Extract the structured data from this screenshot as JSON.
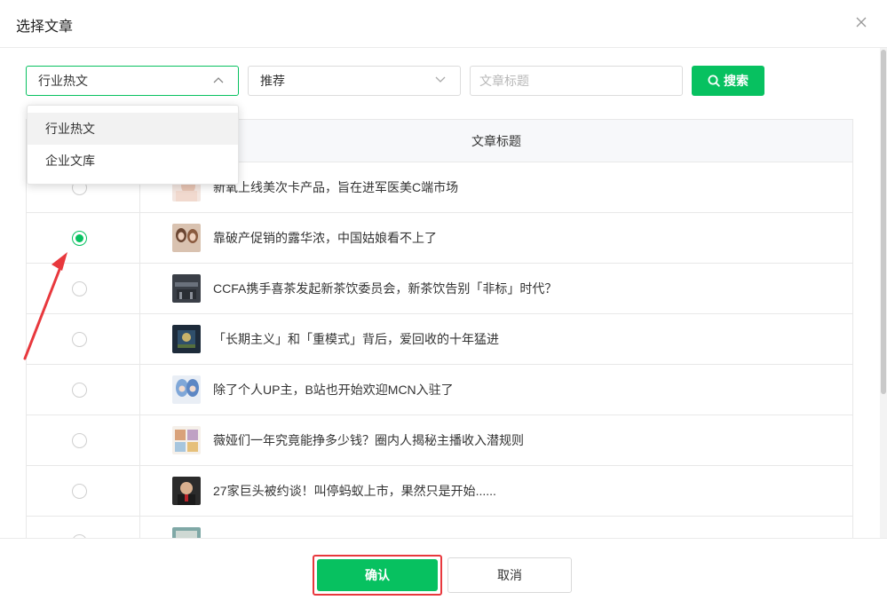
{
  "dialog": {
    "title": "选择文章"
  },
  "filters": {
    "type_select": {
      "value": "行业热文",
      "options": [
        "行业热文",
        "企业文库"
      ]
    },
    "recommend_select": {
      "value": "推荐"
    },
    "title_input": {
      "placeholder": "文章标题",
      "value": ""
    },
    "search_label": "搜索"
  },
  "table": {
    "header": {
      "title": "文章标题"
    },
    "selected_index": 1,
    "rows": [
      {
        "title": "新氧上线美次卡产品，旨在进军医美C端市场",
        "checked": false
      },
      {
        "title": "靠破产促销的露华浓，中国姑娘看不上了",
        "checked": true
      },
      {
        "title": "CCFA携手喜茶发起新茶饮委员会，新茶饮告别「非标」时代？",
        "checked": false
      },
      {
        "title": "「长期主义」和「重模式」背后，爱回收的十年猛进",
        "checked": false
      },
      {
        "title": "除了个人UP主，B站也开始欢迎MCN入驻了",
        "checked": false
      },
      {
        "title": "薇娅们一年究竟能挣多少钱？圈内人揭秘主播收入潜规则",
        "checked": false
      },
      {
        "title": "27家巨头被约谈！叫停蚂蚁上市，果然只是开始......",
        "checked": false
      }
    ]
  },
  "footer": {
    "confirm_label": "确认",
    "cancel_label": "取消"
  },
  "colors": {
    "accent": "#07c160",
    "highlight": "#e8383d"
  }
}
